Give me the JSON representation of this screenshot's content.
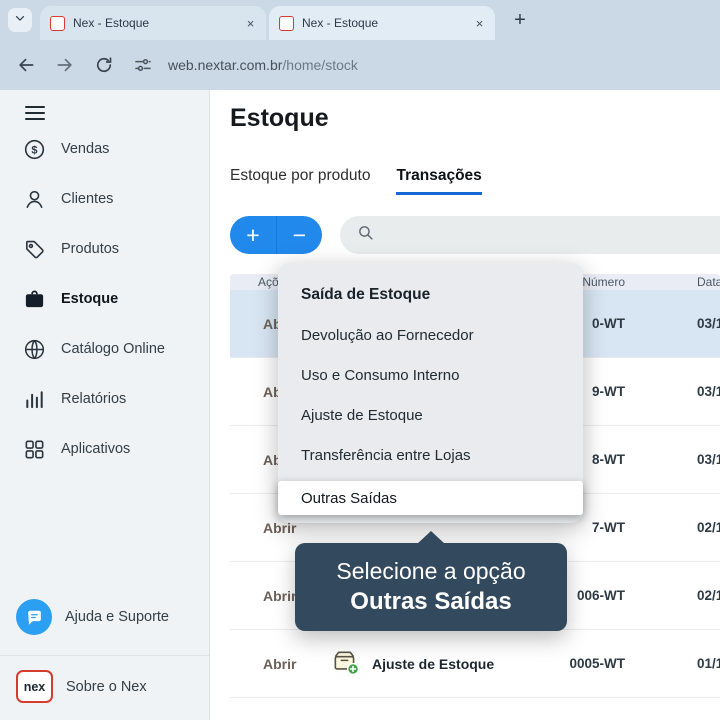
{
  "browser": {
    "tabs": [
      {
        "title": "Nex - Estoque"
      },
      {
        "title": "Nex - Estoque"
      }
    ],
    "tab_close": "×",
    "new_tab": "+",
    "url": {
      "domain": "web.nextar.com.br",
      "path": "/home/stock"
    }
  },
  "sidebar": {
    "items": [
      {
        "label": "Vendas"
      },
      {
        "label": "Clientes"
      },
      {
        "label": "Produtos"
      },
      {
        "label": "Estoque"
      },
      {
        "label": "Catálogo Online"
      },
      {
        "label": "Relatórios"
      },
      {
        "label": "Aplicativos"
      }
    ],
    "help_label": "Ajuda e Suporte",
    "about_label": "Sobre o Nex",
    "logo_text": "nex"
  },
  "main": {
    "title": "Estoque",
    "tabs": [
      {
        "label": "Estoque por produto"
      },
      {
        "label": "Transações"
      }
    ]
  },
  "toolbar": {
    "add_label": "+",
    "remove_label": "−"
  },
  "table": {
    "headers": {
      "actions": "Ações",
      "number": "Número",
      "date": "Data"
    },
    "rows": [
      {
        "action": "Abrir",
        "tipo": "",
        "number": "0-WT",
        "date": "03/1"
      },
      {
        "action": "Abrir",
        "tipo": "",
        "number": "9-WT",
        "date": "03/1"
      },
      {
        "action": "Abrir",
        "tipo": "",
        "number": "8-WT",
        "date": "03/1"
      },
      {
        "action": "Abrir",
        "tipo": "",
        "number": "7-WT",
        "date": "02/1"
      },
      {
        "action": "Abrir",
        "tipo": "",
        "number": "006-WT",
        "date": "02/1"
      },
      {
        "action": "Abrir",
        "tipo": "Ajuste de Estoque",
        "number": "0005-WT",
        "date": "01/1"
      }
    ]
  },
  "menu": {
    "header": "Saída de Estoque",
    "items": [
      {
        "label": "Devolução ao Fornecedor"
      },
      {
        "label": "Uso e Consumo Interno"
      },
      {
        "label": "Ajuste de Estoque"
      },
      {
        "label": "Transferência entre Lojas"
      }
    ],
    "highlighted": "Outras Saídas"
  },
  "tooltip": {
    "line1": "Selecione a opção",
    "line2": "Outras Saídas"
  },
  "colors": {
    "accent_blue": "#2289ec",
    "tab_underline": "#1568d4",
    "selected_row": "#d8e6f4",
    "tooltip_bg": "#33495d",
    "chrome_bg": "#cad9e5"
  }
}
